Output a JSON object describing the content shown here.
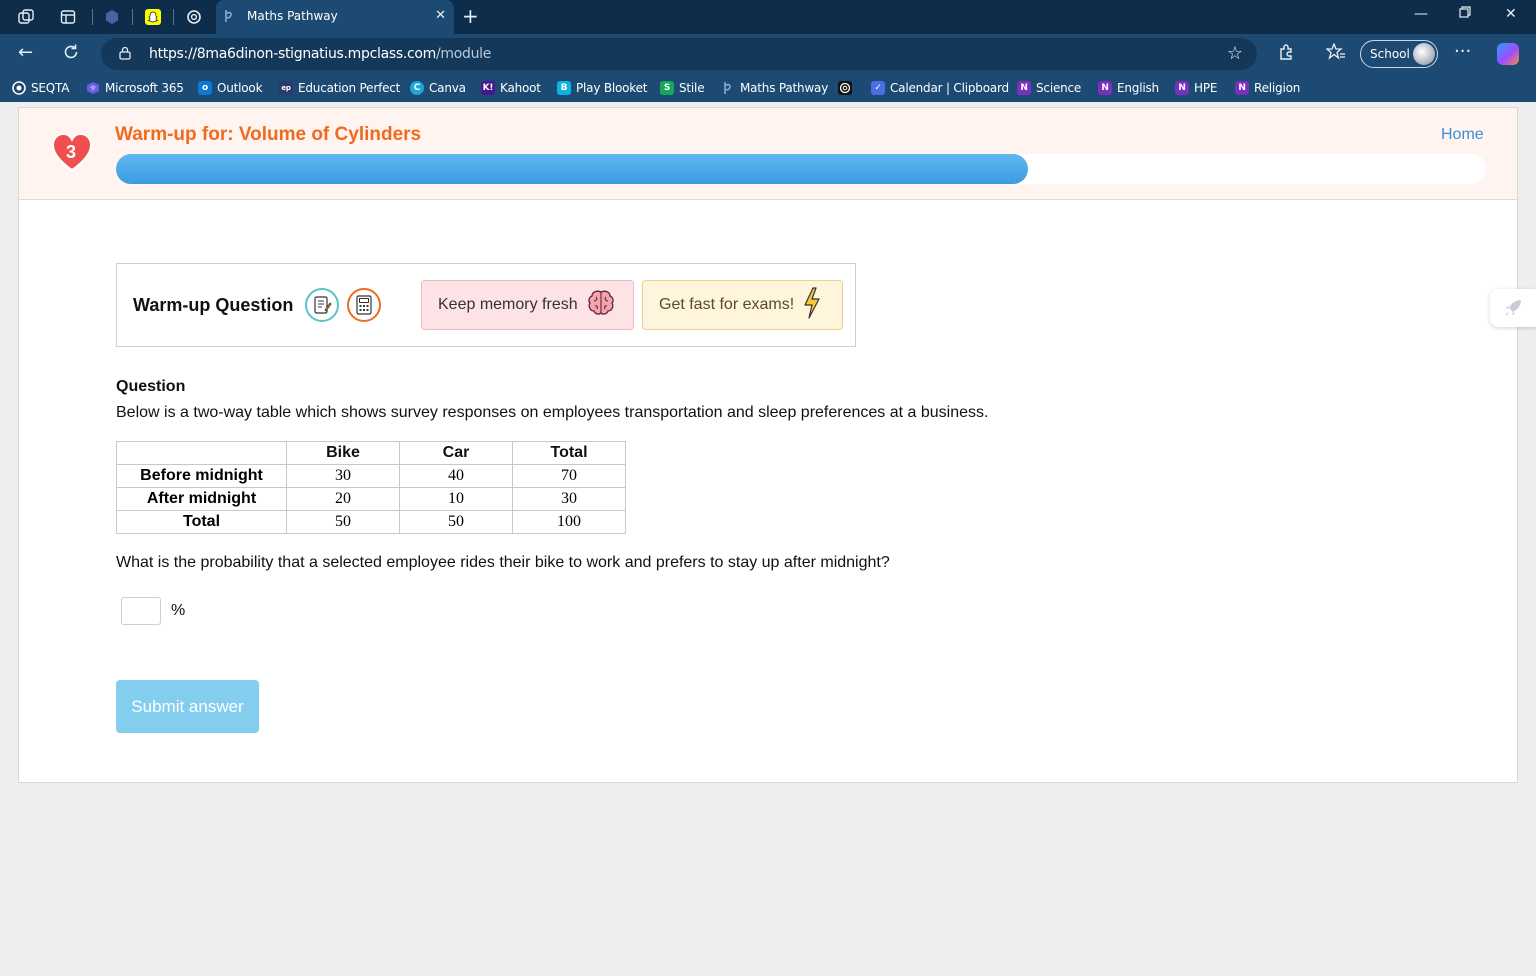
{
  "browser": {
    "active_tab_title": "Maths Pathway",
    "url_host": "https://8ma6dinon-stignatius.mpclass.com",
    "url_path": "/module",
    "profile_label": "School",
    "bookmarks": [
      {
        "label": "SEQTA",
        "icon": "seqta-icon",
        "color": "#1d4a73"
      },
      {
        "label": "Microsoft 365",
        "icon": "microsoft365-icon",
        "color": "#6c5ce7"
      },
      {
        "label": "Outlook",
        "icon": "outlook-icon",
        "color": "#0f78d4"
      },
      {
        "label": "Education Perfect",
        "icon": "education-perfect-icon",
        "color": "#2a3b6b"
      },
      {
        "label": "Canva",
        "icon": "canva-icon",
        "color": "#1fa7d8"
      },
      {
        "label": "Kahoot",
        "icon": "kahoot-icon",
        "color": "#46178f"
      },
      {
        "label": "Play Blooket",
        "icon": "blooket-icon",
        "color": "#0bb4e0"
      },
      {
        "label": "Stile",
        "icon": "stile-icon",
        "color": "#14a85a"
      },
      {
        "label": "Maths Pathway",
        "icon": "maths-pathway-icon",
        "color": "#5b86b3"
      },
      {
        "label": "",
        "icon": "chatgpt-icon",
        "color": "#111111"
      },
      {
        "label": "Calendar | Clipboard",
        "icon": "clipboard-icon",
        "color": "#4a6fe3"
      },
      {
        "label": "Science",
        "icon": "onenote-icon",
        "color": "#7b2fbe"
      },
      {
        "label": "English",
        "icon": "onenote-icon",
        "color": "#7b2fbe"
      },
      {
        "label": "HPE",
        "icon": "onenote-icon",
        "color": "#7b2fbe"
      },
      {
        "label": "Religion",
        "icon": "onenote-icon",
        "color": "#7b2fbe"
      }
    ]
  },
  "header": {
    "lives": "3",
    "title": "Warm-up for: Volume of Cylinders",
    "home_label": "Home",
    "progress_fraction": 0.666
  },
  "card": {
    "title": "Warm-up Question",
    "memory_label": "Keep memory fresh",
    "exam_label": "Get fast for exams!"
  },
  "question": {
    "heading": "Question",
    "text": "Below is a two-way table which shows survey responses on employees transportation and sleep preferences at a business.",
    "table": {
      "columns": [
        "",
        "Bike",
        "Car",
        "Total"
      ],
      "rows": [
        [
          "Before midnight",
          "30",
          "40",
          "70"
        ],
        [
          "After midnight",
          "20",
          "10",
          "30"
        ],
        [
          "Total",
          "50",
          "50",
          "100"
        ]
      ]
    },
    "prompt": "What is the probability that a selected employee rides their bike to work and prefers to stay up after midnight?",
    "answer_value": "",
    "unit": "%",
    "submit_label": "Submit answer"
  },
  "colors": {
    "accent_orange": "#ef6b1f",
    "progress_blue": "#3c9be0",
    "submit_disabled": "#83cdee"
  }
}
